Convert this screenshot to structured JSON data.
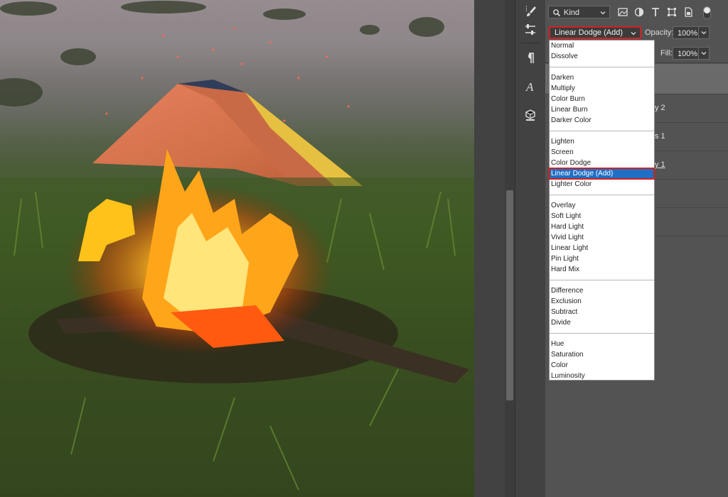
{
  "filter": {
    "kind_label": "Kind"
  },
  "blend": {
    "current": "Linear Dodge (Add)",
    "opacity_label": "Opacity:",
    "opacity_value": "100%",
    "fill_label": "Fill:",
    "fill_value": "100%"
  },
  "layers": [
    {
      "name_fragment": "y 2"
    },
    {
      "name_fragment": "s 1"
    },
    {
      "name_fragment": "y 1"
    }
  ],
  "blend_menu": {
    "groups": [
      [
        "Normal",
        "Dissolve"
      ],
      [
        "Darken",
        "Multiply",
        "Color Burn",
        "Linear Burn",
        "Darker Color"
      ],
      [
        "Lighten",
        "Screen",
        "Color Dodge",
        "Linear Dodge (Add)",
        "Lighter Color"
      ],
      [
        "Overlay",
        "Soft Light",
        "Hard Light",
        "Vivid Light",
        "Linear Light",
        "Pin Light",
        "Hard Mix"
      ],
      [
        "Difference",
        "Exclusion",
        "Subtract",
        "Divide"
      ],
      [
        "Hue",
        "Saturation",
        "Color",
        "Luminosity"
      ]
    ],
    "selected": "Linear Dodge (Add)"
  },
  "tools": [
    "brush-icon",
    "sliders-icon",
    "paragraph-icon",
    "character-icon",
    "3d-cube-icon"
  ],
  "colors": {
    "highlight": "#1f6fc4",
    "annotation": "#d42020",
    "panel": "#535353"
  }
}
